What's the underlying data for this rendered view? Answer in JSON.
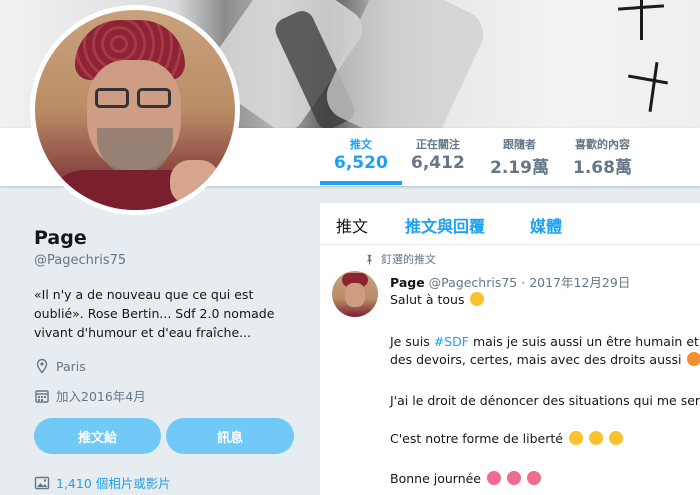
{
  "profile": {
    "name": "Page",
    "handle": "@Pagechris75",
    "bio_line1": "«Il n'y a de nouveau que ce qui est",
    "bio_line2": "oublié». Rose Bertin... Sdf 2.0 nomade",
    "bio_line3": "vivant d'humour et d'eau fraîche...",
    "location": "Paris",
    "joined": "加入2016年4月",
    "tweet_button": "推文給",
    "message_button": "訊息",
    "photos_label": "1,410 個相片或影片"
  },
  "stats": [
    {
      "label": "推文",
      "value": "6,520",
      "active": true
    },
    {
      "label": "正在關注",
      "value": "6,412",
      "active": false
    },
    {
      "label": "跟隨者",
      "value": "2.19萬",
      "active": false
    },
    {
      "label": "喜歡的內容",
      "value": "1.68萬",
      "active": false
    }
  ],
  "tabs": [
    {
      "label": "推文",
      "active": true
    },
    {
      "label": "推文與回覆",
      "active": false
    },
    {
      "label": "媒體",
      "active": false
    }
  ],
  "pinned": {
    "label": "釘選的推文",
    "author_name": "Page",
    "author_handle": "@Pagechris75",
    "date": "· 2017年12月29日",
    "line1": "Salut à tous",
    "line2_pre": "Je suis ",
    "line2_tag": "#SDF",
    "line2_post": " mais je suis aussi un être humain et u",
    "line3": "des devoirs, certes, mais avec des droits aussi",
    "line4": "J'ai le droit de dénoncer des situations qui me sem",
    "line5": "C'est notre forme de liberté",
    "line6": "Bonne journée"
  },
  "colors": {
    "accent": "#1da1f2",
    "button": "#71c9f8",
    "muted": "#657786",
    "background": "#e6ecf0"
  },
  "icons": [
    "location-pin-icon",
    "calendar-icon",
    "photo-icon",
    "pin-icon",
    "emoji-icon"
  ]
}
